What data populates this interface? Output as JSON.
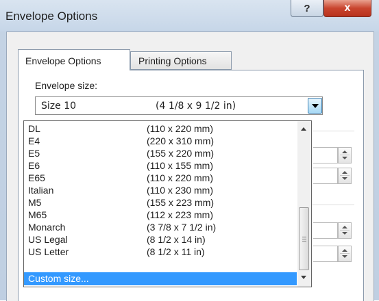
{
  "window": {
    "title": "Envelope Options",
    "help_glyph": "?",
    "close_glyph": "x"
  },
  "tabs": [
    {
      "label": "Envelope Options",
      "active": true
    },
    {
      "label": "Printing Options",
      "active": false
    }
  ],
  "envelope_size": {
    "label": "Envelope size:",
    "selected_name": "Size 10",
    "selected_dims": "(4 1/8 x 9 1/2 in)"
  },
  "dropdown": {
    "items": [
      {
        "name": "DL",
        "dims": "(110 x 220 mm)"
      },
      {
        "name": "E4",
        "dims": "(220 x 310 mm)"
      },
      {
        "name": "E5",
        "dims": "(155 x 220 mm)"
      },
      {
        "name": "E6",
        "dims": "(110 x 155 mm)"
      },
      {
        "name": "E65",
        "dims": "(110 x 220 mm)"
      },
      {
        "name": "Italian",
        "dims": "(110 x 230 mm)"
      },
      {
        "name": "M5",
        "dims": "(155 x 223 mm)"
      },
      {
        "name": "M65",
        "dims": "(112 x 223 mm)"
      },
      {
        "name": "Monarch",
        "dims": "(3 7/8 x 7 1/2 in)"
      },
      {
        "name": "US Legal",
        "dims": "(8 1/2 x 14 in)"
      },
      {
        "name": "US Letter",
        "dims": "(8 1/2 x 11 in)"
      },
      {
        "name": "Custom size...",
        "dims": ""
      }
    ],
    "highlighted_index": 11
  },
  "colors": {
    "selection": "#3399ff",
    "close_button": "#c9452f",
    "window_frame": "#c4d3e4"
  }
}
